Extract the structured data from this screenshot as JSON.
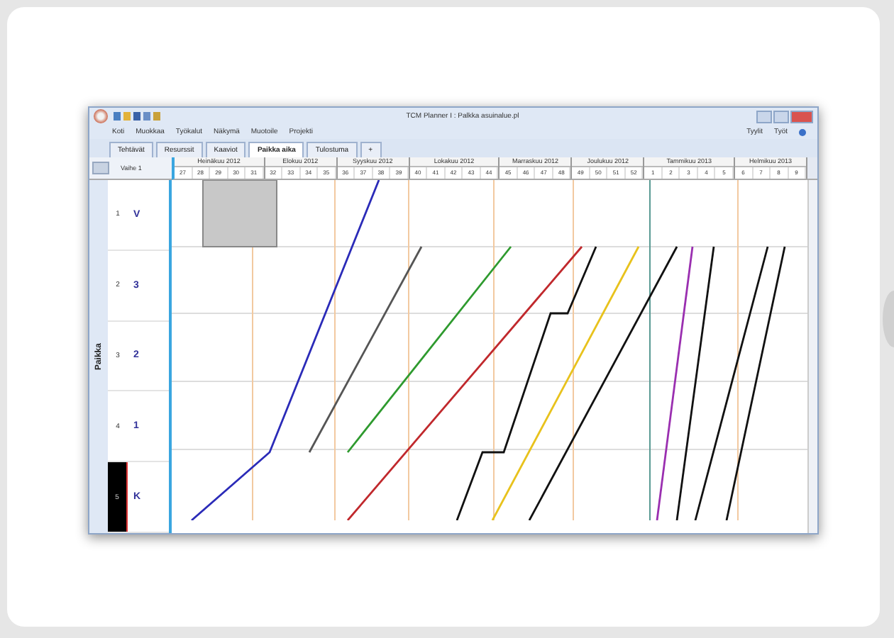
{
  "window": {
    "title": "TCM Planner I : Palkka asuinalue.pl"
  },
  "menu": [
    "Koti",
    "Muokkaa",
    "Työkalut",
    "Näkymä",
    "Muotoile",
    "Projekti"
  ],
  "menu_right": [
    "Tyylit",
    "Työt"
  ],
  "tabs": [
    {
      "label": "Tehtävät",
      "selected": false
    },
    {
      "label": "Resurssit",
      "selected": false
    },
    {
      "label": "Kaaviot",
      "selected": false
    },
    {
      "label": "Paikka aika",
      "selected": true
    },
    {
      "label": "Tulostuma",
      "selected": false
    },
    {
      "label": "+",
      "selected": false
    }
  ],
  "grid": {
    "corner_label": "Vaihe 1",
    "axis_label": "Paikka",
    "months": [
      {
        "label": "Heinäkuu 2012",
        "weeks": [
          "27",
          "28",
          "29",
          "30",
          "31"
        ]
      },
      {
        "label": "Elokuu 2012",
        "weeks": [
          "32",
          "33",
          "34",
          "35"
        ]
      },
      {
        "label": "Syyskuu 2012",
        "weeks": [
          "36",
          "37",
          "38",
          "39"
        ]
      },
      {
        "label": "Lokakuu 2012",
        "weeks": [
          "40",
          "41",
          "42",
          "43",
          "44"
        ]
      },
      {
        "label": "Marraskuu 2012",
        "weeks": [
          "45",
          "46",
          "47",
          "48"
        ]
      },
      {
        "label": "Joulukuu 2012",
        "weeks": [
          "49",
          "50",
          "51",
          "52"
        ]
      },
      {
        "label": "Tammikuu 2013",
        "weeks": [
          "1",
          "2",
          "3",
          "4",
          "5"
        ]
      },
      {
        "label": "Helmikuu 2013",
        "weeks": [
          "6",
          "7",
          "8",
          "9"
        ]
      }
    ],
    "rows": [
      {
        "number": "1",
        "label": "V",
        "selected": false
      },
      {
        "number": "2",
        "label": "3",
        "selected": false
      },
      {
        "number": "3",
        "label": "2",
        "selected": false
      },
      {
        "number": "4",
        "label": "1",
        "selected": false
      },
      {
        "number": "5",
        "label": "K",
        "selected": true
      }
    ]
  }
}
